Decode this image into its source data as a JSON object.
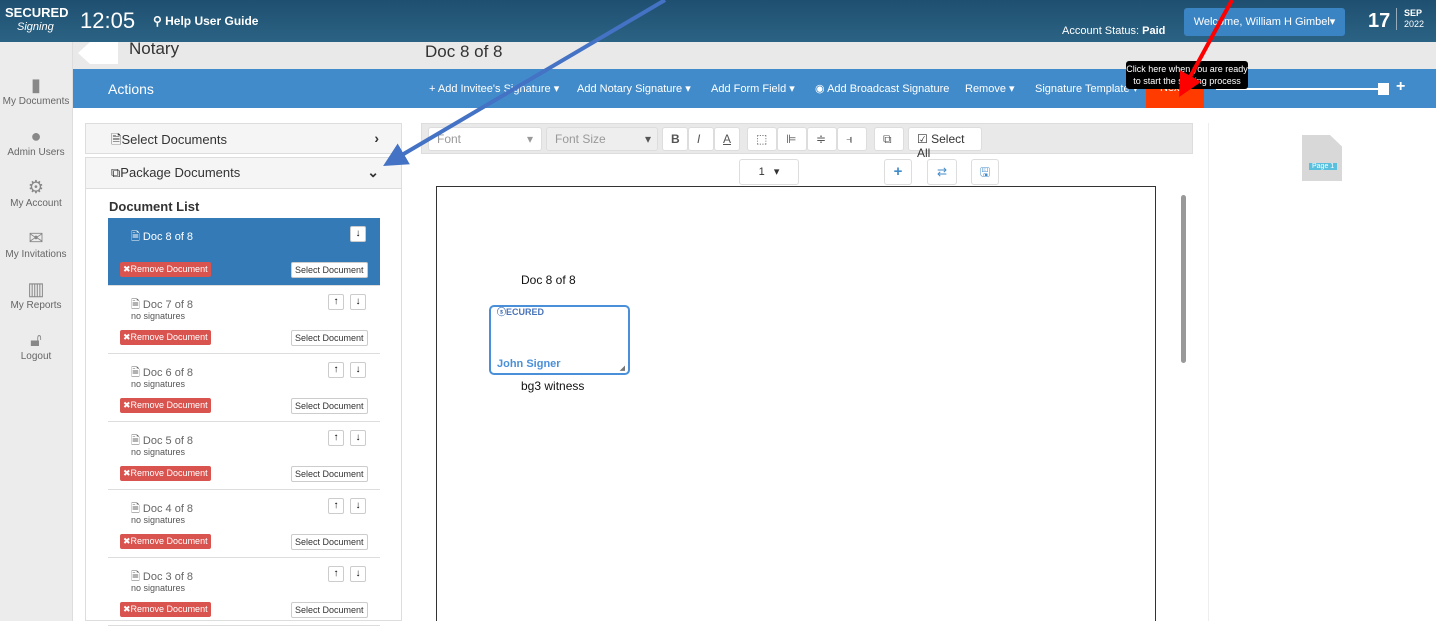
{
  "header": {
    "logo": "SECURED Signing",
    "time": "12:05",
    "help": "Help User Guide",
    "account_label": "Account Status:",
    "account_value": "Paid",
    "welcome": "Welcome,  William H Gimbel",
    "day": "17",
    "month": "SEP",
    "year": "2022"
  },
  "sidebar": {
    "items": [
      {
        "label": "My Documents",
        "icon": "document-icon"
      },
      {
        "label": "Admin Users",
        "icon": "user-icon"
      },
      {
        "label": "My Account",
        "icon": "gear-icon"
      },
      {
        "label": "My Invitations",
        "icon": "envelope-icon"
      },
      {
        "label": "My Reports",
        "icon": "chart-icon"
      },
      {
        "label": "Logout",
        "icon": "lock-icon"
      }
    ]
  },
  "subheader": {
    "title": "Notary",
    "doc": "Doc 8 of 8"
  },
  "actions": {
    "label": "Actions",
    "menu": [
      "+ Add Invitee's Signature ▾",
      "Add Notary Signature ▾",
      "Add Form Field ▾",
      "Add Broadcast Signature",
      "Remove ▾",
      "Signature Template ▾"
    ],
    "next": "Next",
    "tooltip": "Click here when you are ready to start the signing process",
    "zoom_level": 1.0
  },
  "panels": {
    "select": "Select Documents",
    "package": "Package Documents",
    "list_title": "Document List"
  },
  "documents": [
    {
      "name": "Doc 8 of 8",
      "status": "",
      "active": true
    },
    {
      "name": "Doc 7 of 8",
      "status": "no signatures"
    },
    {
      "name": "Doc 6 of 8",
      "status": "no signatures"
    },
    {
      "name": "Doc 5 of 8",
      "status": "no signatures"
    },
    {
      "name": "Doc 4 of 8",
      "status": "no signatures"
    },
    {
      "name": "Doc 3 of 8",
      "status": "no signatures"
    }
  ],
  "doc_buttons": {
    "remove": "✖Remove Document",
    "select": "Select Document"
  },
  "toolbar": {
    "font": "Font",
    "font_size": "Font Size",
    "select_all": "Select All",
    "page": "1"
  },
  "canvas": {
    "doc_title": "Doc 8 of 8",
    "signer": "John Signer",
    "caption": "bg3 witness",
    "thumb": "Page 1"
  },
  "colors": {
    "topbar": "#1f4f70",
    "actions": "#428bca",
    "next": "#ff3b00",
    "remove": "#d9534f"
  }
}
